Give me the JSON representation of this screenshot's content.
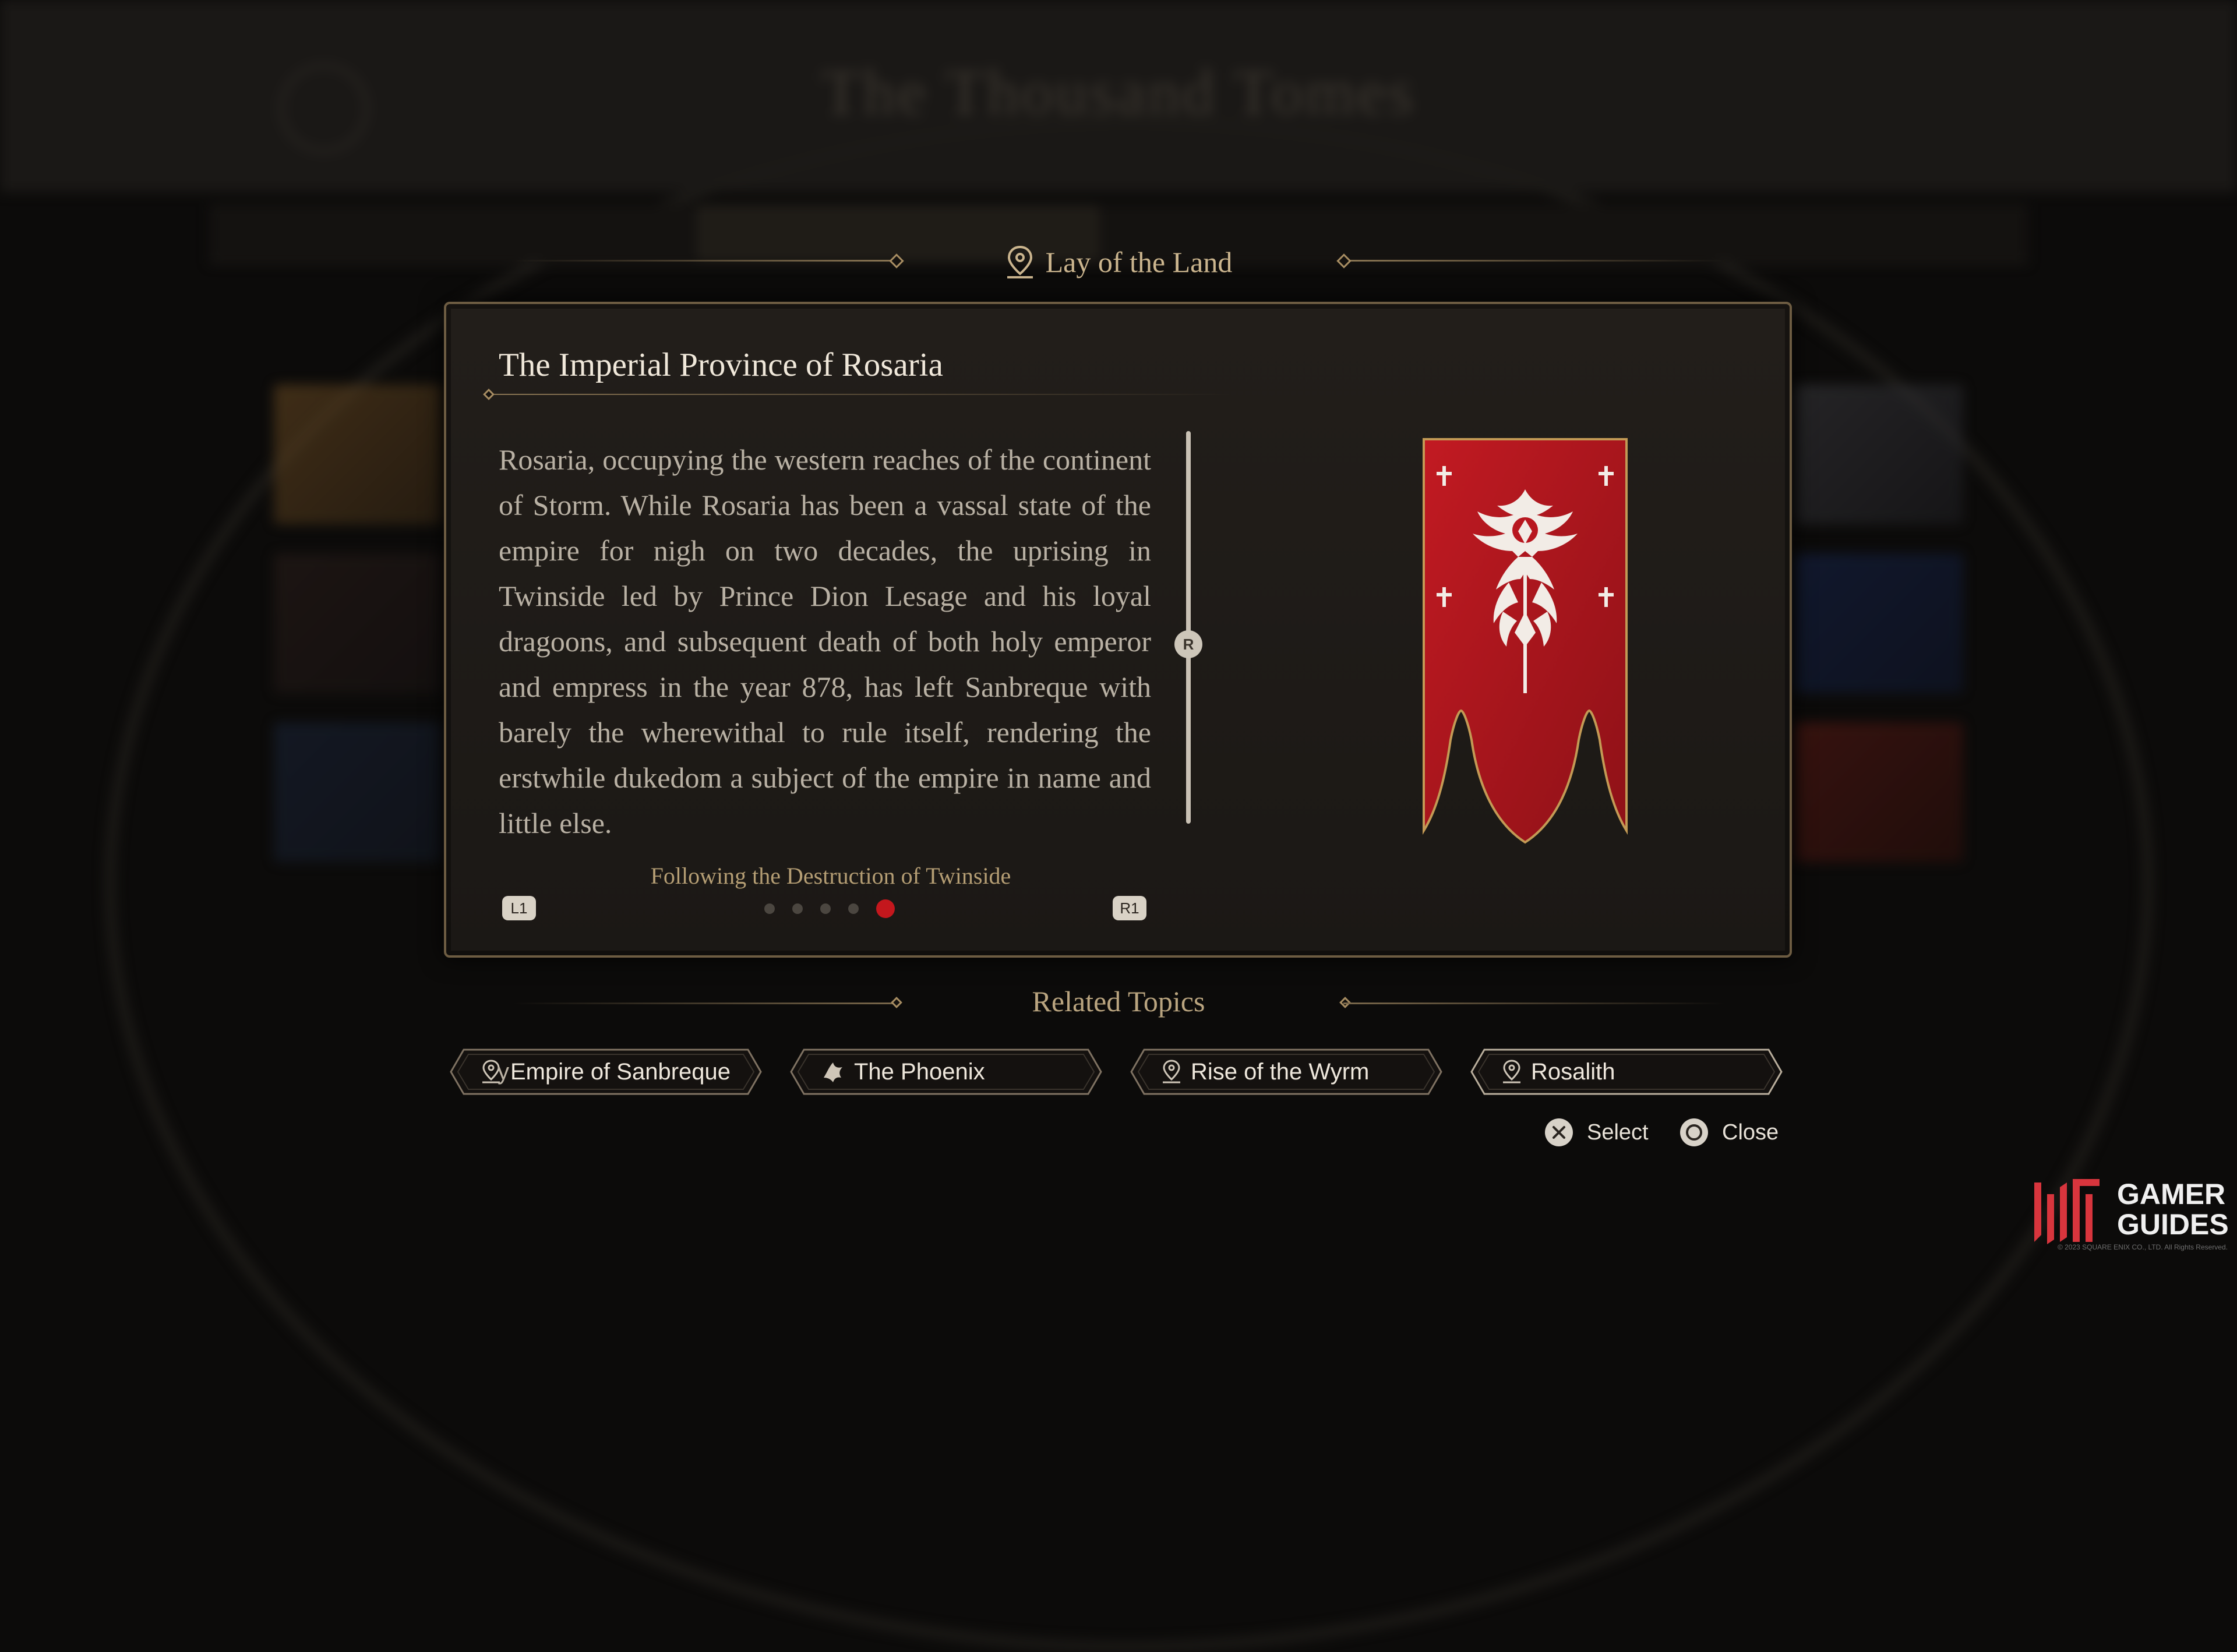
{
  "background": {
    "title": "The Thousand Tomes"
  },
  "header": {
    "icon": "map-pin-icon",
    "title": "Lay of the Land"
  },
  "entry": {
    "title": "The Imperial Province of Rosaria",
    "text_cut": ",                                                            ,",
    "body": "Rosaria, occupying the western reaches of the continent of Storm. While Rosaria has been a vassal state of the empire for nigh on two decades, the uprising in Twinside led by Prince Dion Lesage and his loyal dragoons, and subsequent death of both holy emperor and empress in the year 878, has left Sanbreque with barely the wherewithal to rule itself, rendering the erstwhile dukedom a subject of the empire in name and little else.",
    "page_caption": "Following the Destruction of Twinside",
    "scroll_button": "R",
    "prev_button": "L1",
    "next_button": "R1",
    "pages_total": 5,
    "page_current": 5,
    "banner_icon": "rosaria-phoenix-banner-icon",
    "banner_color": "#b8171f"
  },
  "related": {
    "title": "Related Topics",
    "topics": [
      {
        "label": "Empire of Sanbreque",
        "prefix": "y",
        "icon": "map-pin-icon"
      },
      {
        "label": "The Phoenix",
        "prefix": "",
        "icon": "eikon-icon"
      },
      {
        "label": "Rise of the Wyrm",
        "prefix": "",
        "icon": "map-pin-icon"
      },
      {
        "label": "Rosalith",
        "prefix": "",
        "icon": "map-pin-icon"
      }
    ]
  },
  "controls": {
    "select_label": "Select",
    "select_icon": "cross-button-icon",
    "close_label": "Close",
    "close_icon": "circle-button-icon"
  },
  "watermark": {
    "line1": "GAMER",
    "line2": "GUIDES",
    "copyright": "© 2023 SQUARE ENIX CO., LTD. All Rights Reserved."
  },
  "colors": {
    "accent_gold": "#cbb58e",
    "active_dot": "#c4171d",
    "panel_border": "#6d5c42"
  }
}
